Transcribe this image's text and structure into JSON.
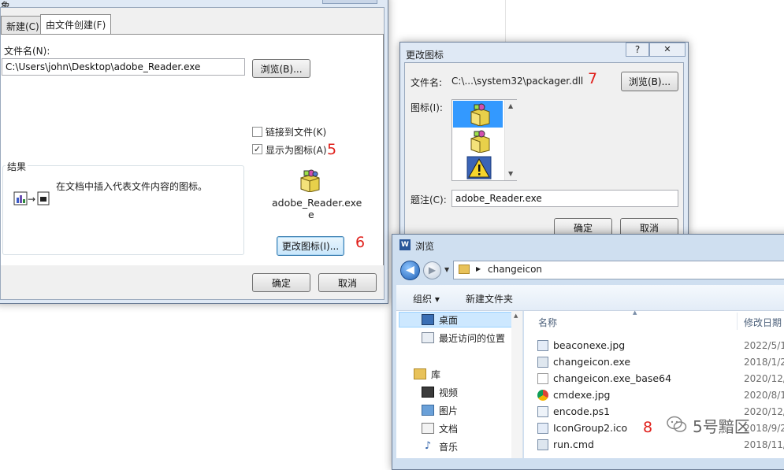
{
  "insert_object_dialog": {
    "title_partial": "象",
    "tabs": [
      "新建(C)",
      "由文件创建(F)"
    ],
    "filename_label": "文件名(N):",
    "filename_value": "C:\\Users\\john\\Desktop\\adobe_Reader.exe",
    "browse_label": "浏览(B)...",
    "link_to_file_label": "链接到文件(K)",
    "display_as_icon_label": "显示为图标(A)",
    "result_group_label": "结果",
    "result_text": "在文档中插入代表文件内容的图标。",
    "icon_caption_line1": "adobe_Reader.exe",
    "icon_caption_line2": "e",
    "change_icon_label": "更改图标(I)...",
    "ok_label": "确定",
    "cancel_label": "取消"
  },
  "change_icon_dialog": {
    "title": "更改图标",
    "help_glyph": "?",
    "close_glyph": "✕",
    "filename_label": "文件名:",
    "filename_value": "C:\\...\\system32\\packager.dll",
    "browse_label": "浏览(B)...",
    "icon_label": "图标(I):",
    "caption_label": "题注(C):",
    "caption_value": "adobe_Reader.exe",
    "ok_label": "确定",
    "cancel_label": "取消"
  },
  "browse_dialog": {
    "title": "浏览",
    "path": "changeicon",
    "organize_label": "组织 ▾",
    "new_folder_label": "新建文件夹",
    "nav_items": [
      {
        "label": "桌面",
        "icon": "desktop-icon"
      },
      {
        "label": "最近访问的位置",
        "icon": "recent-icon"
      },
      {
        "label": "库",
        "icon": "library-icon"
      },
      {
        "label": "视频",
        "icon": "video-icon"
      },
      {
        "label": "图片",
        "icon": "picture-icon"
      },
      {
        "label": "文档",
        "icon": "document-icon"
      },
      {
        "label": "音乐",
        "icon": "music-icon"
      }
    ],
    "col_name": "名称",
    "col_date": "修改日期",
    "files": [
      {
        "name": "beaconexe.jpg",
        "date": "2022/5/1"
      },
      {
        "name": "changeicon.exe",
        "date": "2018/1/2"
      },
      {
        "name": "changeicon.exe_base64",
        "date": "2020/12/"
      },
      {
        "name": "cmdexe.jpg",
        "date": "2020/8/1"
      },
      {
        "name": "encode.ps1",
        "date": "2020/12/"
      },
      {
        "name": "IconGroup2.ico",
        "date": "2018/9/2"
      },
      {
        "name": "run.cmd",
        "date": "2018/11/"
      }
    ]
  },
  "annotations": [
    "5",
    "6",
    "7",
    "8"
  ],
  "watermark": "5号黯区",
  "colors": {
    "annotation": "#e0201b",
    "selection": "#cde8ff",
    "dialog_bg": "#f0f0f0"
  }
}
